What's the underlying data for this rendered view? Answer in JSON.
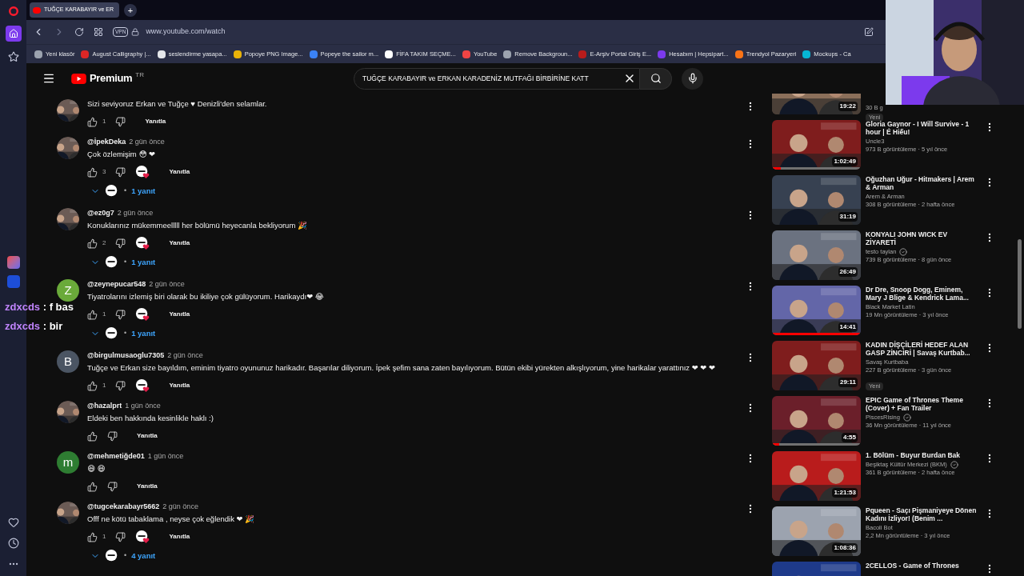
{
  "browser": {
    "tab": {
      "title": "TUĞÇE KARABAYIR ve ER",
      "selected": true
    },
    "new_tab": "+",
    "url": "www.youtube.com/watch",
    "vpn": "VPN",
    "bookmarks": [
      {
        "label": "Yeni klasör",
        "color": "#9ca3af"
      },
      {
        "label": "August Calligraphy |...",
        "color": "#dc2626"
      },
      {
        "label": "seslendirme yasapa...",
        "color": "#e5e7eb"
      },
      {
        "label": "Popoye PNG Image...",
        "color": "#eab308"
      },
      {
        "label": "Popeye the sailor m...",
        "color": "#3b82f6"
      },
      {
        "label": "FİFA TAKIM SEÇME...",
        "color": "#ffffff"
      },
      {
        "label": "YouTube",
        "color": "#ef4444"
      },
      {
        "label": "Remove Backgroun...",
        "color": "#9ca3af"
      },
      {
        "label": "E-Arşiv Portal Giriş E...",
        "color": "#b91c1c"
      },
      {
        "label": "Hesabım | Hepsipart...",
        "color": "#7c3aed"
      },
      {
        "label": "Trendyol Pazaryeri",
        "color": "#f97316"
      },
      {
        "label": "Mockups - Ca",
        "color": "#06b6d4"
      }
    ]
  },
  "masthead": {
    "logo": "Premium",
    "region": "TR",
    "search_value": "TUĞÇE KARABAYIR ve ERKAN KARADENİZ MUTFAĞI BİRBİRİNE KATT"
  },
  "comments": [
    {
      "text": "Sizi seviyoruz Erkan ve Tuğçe ♥ Denizli'den selamlar.",
      "likes": "1",
      "creator_heart": false,
      "reply": "Yanıtla"
    },
    {
      "author": "@İpekDeka",
      "time": "2 gün önce",
      "text": "Çok özlemişim 😳 ❤",
      "likes": "3",
      "creator_heart": true,
      "reply": "Yanıtla",
      "replies": {
        "separator": "•",
        "label": "1 yanıt"
      }
    },
    {
      "author": "@ez0g7",
      "time": "2 gün önce",
      "text": "Konuklarınız mükemmeelllll her bölümü heyecanla bekliyorum 🎉",
      "likes": "2",
      "creator_heart": true,
      "reply": "Yanıtla",
      "replies": {
        "separator": "•",
        "label": "1 yanıt"
      }
    },
    {
      "author": "@zeynepucar548",
      "time": "2 gün önce",
      "text": "Tiyatrolarını izlemiş biri olarak bu ikiliye çok gülüyorum. Harikaydı❤ 😂",
      "likes": "1",
      "creator_heart": true,
      "reply": "Yanıtla",
      "replies": {
        "separator": "•",
        "label": "1 yanıt"
      },
      "avatar": {
        "kind": "letter",
        "letter": "Z",
        "color": "#6aaa3a"
      }
    },
    {
      "author": "@birgulmusaoglu7305",
      "time": "2 gün önce",
      "text": "Tuğçe ve Erkan size bayıldım, eminim tiyatro oyununuz harikadır. Başarılar diliyorum. İpek şefim sana zaten bayılıyorum. Bütün ekibi yürekten alkışlıyorum, yine harikalar yarattınız ❤ ❤ ❤",
      "likes": "1",
      "creator_heart": true,
      "reply": "Yanıtla",
      "avatar": {
        "kind": "letter",
        "letter": "B",
        "color": "#4b5563"
      }
    },
    {
      "author": "@hazalprt",
      "time": "1 gün önce",
      "text": "Eldeki ben hakkında kesinlikle haklı :)",
      "creator_heart": false,
      "reply": "Yanıtla"
    },
    {
      "author": "@mehmetiğde01",
      "time": "1 gün önce",
      "text": "😄 😄",
      "creator_heart": false,
      "reply": "Yanıtla",
      "avatar": {
        "kind": "letter",
        "letter": "m",
        "color": "#2e7d32"
      }
    },
    {
      "author": "@tugcekarabayr5662",
      "time": "2 gün önce",
      "text": "Offf ne kötü tabaklama , neyse çok eğlendik ❤ 🎉",
      "likes": "1",
      "creator_heart": true,
      "reply": "Yanıtla",
      "replies": {
        "separator": "•",
        "label": "4 yanıt"
      }
    }
  ],
  "videos": [
    {
      "meta": "30 B g",
      "duration": "19:22",
      "badge": "Yeni",
      "verified": false
    },
    {
      "title": "Gloria Gaynor - I Will Survive - 1 hour | É Hiếu!",
      "channel": "Uncle3",
      "meta": "973 B görüntüleme · 5 yıl önce",
      "duration": "1:02:49",
      "level": 0.1,
      "verified": false
    },
    {
      "title": "Oğuzhan Uğur - Hitmakers | Arem & Arman",
      "channel": "Arem & Arman",
      "meta": "308 B görüntüleme · 2 hafta önce",
      "duration": "31:19",
      "verified": false
    },
    {
      "title": "KONYALI JOHN WICK EV ZİYARETİ",
      "channel": "testo taylan",
      "meta": "739 B görüntüleme · 8 gün önce",
      "duration": "26:49",
      "verified": true
    },
    {
      "title": "Dr  Dre, Snoop Dogg, Eminem, Mary J  Blige & Kendrick Lama...",
      "channel": "Black Market Latin",
      "meta": "19 Mn görüntüleme · 3 yıl önce",
      "duration": "14:41",
      "level": 1,
      "verified": false
    },
    {
      "title": "KADIN DİŞÇİLERİ HEDEF ALAN GASP ZİNCİRİ | Savaş Kurtbab...",
      "channel": "Savaş Kurtbaba",
      "meta": "227 B görüntüleme · 3 gün önce",
      "duration": "29:11",
      "badge": "Yeni",
      "verified": false
    },
    {
      "title": "EPIC Game of Thrones Theme (Cover) + Fan Trailer",
      "channel": "PiscesRising",
      "meta": "36 Mn görüntüleme · 11 yıl önce",
      "duration": "4:55",
      "level": 0.08,
      "verified": true
    },
    {
      "title": "1. Bölüm - Buyur Burdan Bak",
      "channel": "Beşiktaş Kültür Merkezi (BKM)",
      "meta": "361 B görüntüleme · 2 hafta önce",
      "duration": "1:21:53",
      "verified": true
    },
    {
      "title": "Pqueen - Saçı Pişmaniyeye Dönen Kadını İzliyor! (Benim ...",
      "channel": "Bacoli Bot",
      "meta": "2,2 Mn görüntüleme · 3 yıl önce",
      "duration": "1:08:36",
      "verified": false
    },
    {
      "title": "2CELLOS - Game of Thrones",
      "verified": false
    }
  ],
  "chat_overlay": [
    {
      "user": "zdxcds",
      "message": ": f bas"
    },
    {
      "user": "zdxcds",
      "message": ": bir"
    }
  ]
}
